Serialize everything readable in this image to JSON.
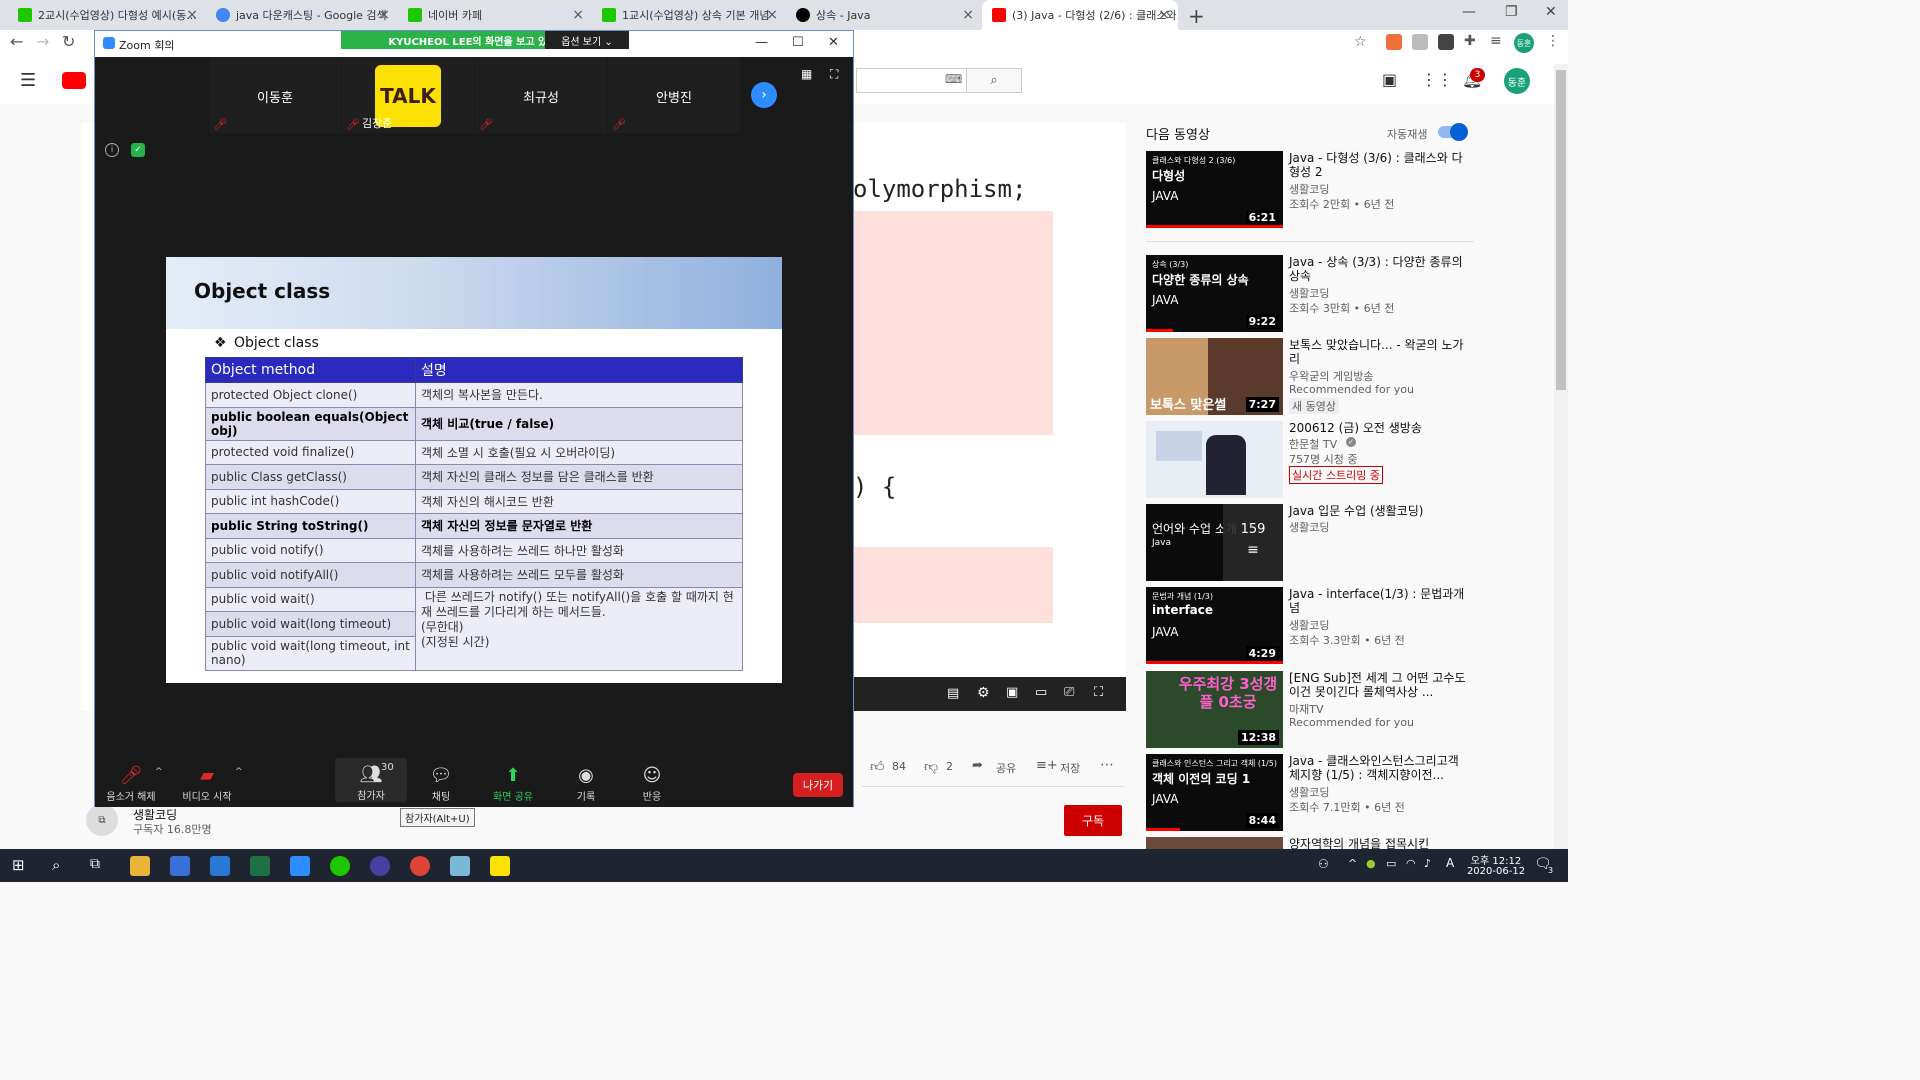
{
  "browser": {
    "tabs": [
      {
        "title": "2교시(수업영상) 다형성 예시(동...",
        "color": "#1ec800"
      },
      {
        "title": "java 다운캐스팅 - Google 검색",
        "color": "#4285f4"
      },
      {
        "title": "네이버 카페",
        "color": "#1ec800"
      },
      {
        "title": "1교시(수업영상) 상속 기본 개념",
        "color": "#1ec800"
      },
      {
        "title": "상속 - Java",
        "color": "#000000"
      },
      {
        "title": "(3) Java - 다형성 (2/6) : 클래스와...",
        "color": "#ff0000"
      }
    ],
    "new_tab": "+",
    "profile": "동훈"
  },
  "zoom": {
    "title": "Zoom 회의",
    "sharing_banner": "KYUCHEOL LEE의 화면을 보고 있습니다.",
    "view_options": "옵션 보기 ⌄",
    "participants": [
      {
        "name": "이동훈"
      },
      {
        "name": "김장준",
        "avatar_text": "TALK"
      },
      {
        "name": "최규성"
      },
      {
        "name": "안병진"
      }
    ],
    "slide": {
      "title": "Object class",
      "bullet": "Object class",
      "headers": [
        "Object method",
        "설명"
      ],
      "rows": [
        {
          "method": "protected Object clone()",
          "desc": "객체의 복사본을 만든다."
        },
        {
          "method": "public boolean equals(Object obj)",
          "desc": "객체 비교(true / false)"
        },
        {
          "method": "protected void finalize()",
          "desc": "객체 소멸 시 호출(필요 시 오버라이딩)"
        },
        {
          "method": "public Class getClass()",
          "desc": "객체 자신의 클래스 정보를 담은 클래스를 반환"
        },
        {
          "method": "public int hashCode()",
          "desc": "객체 자신의 해시코드 반환"
        },
        {
          "method": "public String toString()",
          "desc": "객체 자신의 정보를 문자열로 반환"
        },
        {
          "method": "public void notify()",
          "desc": "객체를 사용하려는 쓰레드 하나만 활성화"
        },
        {
          "method": "public void notifyAll()",
          "desc": "객체를 사용하려는 쓰레드 모두를 활성화"
        }
      ],
      "wait_methods": [
        "public void wait()",
        "public void wait(long timeout)",
        "public void wait(long timeout, int nano)"
      ],
      "wait_desc": " 다른 쓰레드가 notify() 또는 notifyAll()을 호출 할 때까지 현재 쓰레드를 기다리게 하는 메서드들.\n(무한대)\n(지정된 시간)"
    },
    "controls": {
      "mute": "음소거 해제",
      "video": "비디오 시작",
      "participants": "참가자",
      "participant_count": "30",
      "chat": "채팅",
      "share": "화면 공유",
      "record": "기록",
      "reactions": "반응",
      "leave": "나가기",
      "tooltip": "참가자(Alt+U)"
    }
  },
  "youtube": {
    "code_line1": "olymorphism;",
    "code_line2": ") {",
    "likes": "84",
    "dislikes": "2",
    "share": "공유",
    "save": "저장",
    "channel": "생활코딩",
    "subscribers": "구독자 16.8만명",
    "subscribe": "구독",
    "up_next": "다음 동영상",
    "autoplay": "자동재생",
    "notification_count": "3",
    "recommendations": [
      {
        "thumb_small": "클래스와 다형성 2 (3/6)",
        "thumb_big": "다형성",
        "thumb_lang": "JAVA",
        "duration": "6:21",
        "title": "Java - 다형성 (3/6) : 클래스와 다형성 2",
        "channel": "생활코딩",
        "meta": "조회수 2만회 • 6년 전",
        "progress": 1.0
      },
      {
        "thumb_small": "상속 (3/3)",
        "thumb_big": "다양한 종류의 상속",
        "thumb_lang": "JAVA",
        "duration": "9:22",
        "title": "Java - 상속 (3/3) : 다양한 종류의 상속",
        "channel": "생활코딩",
        "meta": "조회수 3만회 • 6년 전",
        "progress": 0.2
      },
      {
        "thumb_small": "",
        "thumb_big": "보톡스 맞은썰",
        "thumb_lang": "",
        "duration": "7:27",
        "title": "보톡스 맞았습니다... - 왁굳의 노가리",
        "channel": "우왁굳의 게임방송",
        "meta": "Recommended for you",
        "badge": "새 동영상",
        "progress": 0
      },
      {
        "thumb_small": "",
        "thumb_big": "",
        "thumb_lang": "",
        "duration": "",
        "title": "200612 (금) 오전 생방송",
        "channel": "한문철 TV",
        "meta": "757명 시청 중",
        "badge": "실시간 스트리밍 중",
        "progress": 0
      },
      {
        "thumb_small": "",
        "thumb_big": "언어와 수업 소개",
        "thumb_lang": "Java",
        "duration": "159",
        "title": "Java 입문 수업 (생활코딩)",
        "channel": "생활코딩",
        "meta": "",
        "progress": 0
      },
      {
        "thumb_small": "문법과 개념 (1/3)",
        "thumb_big": "interface",
        "thumb_lang": "JAVA",
        "duration": "4:29",
        "title": "Java - interface(1/3) : 문법과개념",
        "channel": "생활코딩",
        "meta": "조회수 3.3만회 • 6년 전",
        "progress": 1.0
      },
      {
        "thumb_small": "",
        "thumb_big": "우주최강 3성갱플 0초궁",
        "thumb_lang": "",
        "duration": "12:38",
        "title": "[ENG Sub]전 세계 그 어떤 고수도 이건 못이긴다 롤체역사상 ...",
        "channel": "마재TV",
        "meta": "Recommended for you",
        "progress": 0
      },
      {
        "thumb_small": "클래스와 인스턴스 그리고 객체 (1/5)",
        "thumb_big": "객체 이전의 코딩 1",
        "thumb_lang": "JAVA",
        "duration": "8:44",
        "title": "Java - 클래스와인스턴스그리고객체지향 (1/5) : 객체지향이전...",
        "channel": "생활코딩",
        "meta": "조회수 7.1만회 • 6년 전",
        "progress": 0.25
      },
      {
        "thumb_small": "",
        "thumb_big": "",
        "thumb_lang": "",
        "duration": "",
        "title": "양자역학의 개념을 접목시킨",
        "channel": "",
        "meta": "",
        "progress": 0
      }
    ]
  },
  "taskbar": {
    "time": "오후 12:12",
    "date": "2020-06-12",
    "ime": "A",
    "notifications": "3"
  }
}
